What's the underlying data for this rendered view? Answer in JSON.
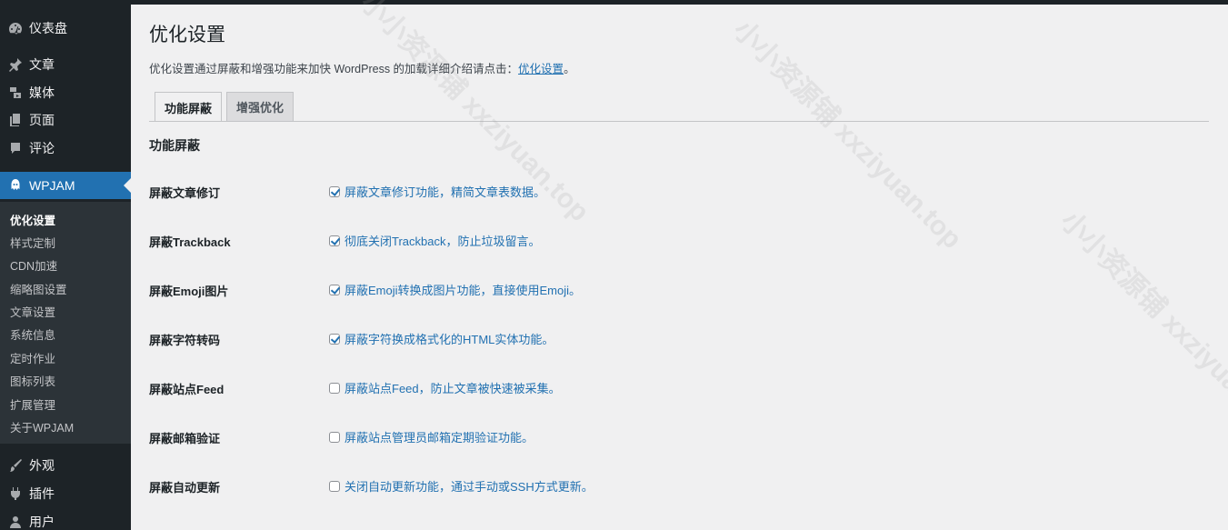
{
  "sidebar": {
    "menu": [
      {
        "label": "仪表盘",
        "icon": "dashboard-icon"
      },
      {
        "label": "文章",
        "icon": "pin-icon"
      },
      {
        "label": "媒体",
        "icon": "media-icon"
      },
      {
        "label": "页面",
        "icon": "page-icon"
      },
      {
        "label": "评论",
        "icon": "comment-icon"
      },
      {
        "label": "WPJAM",
        "icon": "wpjam-icon",
        "current": true
      },
      {
        "label": "外观",
        "icon": "brush-icon"
      },
      {
        "label": "插件",
        "icon": "plugin-icon"
      },
      {
        "label": "用户",
        "icon": "user-icon"
      }
    ],
    "submenu": [
      {
        "label": "优化设置",
        "current": true
      },
      {
        "label": "样式定制"
      },
      {
        "label": "CDN加速"
      },
      {
        "label": "缩略图设置"
      },
      {
        "label": "文章设置"
      },
      {
        "label": "系统信息"
      },
      {
        "label": "定时作业"
      },
      {
        "label": "图标列表"
      },
      {
        "label": "扩展管理"
      },
      {
        "label": "关于WPJAM"
      }
    ]
  },
  "page": {
    "title": "优化设置",
    "description": "优化设置通过屏蔽和增强功能来加快 WordPress 的加载详细介绍请点击：",
    "link_text": "优化设置",
    "link_suffix": "。"
  },
  "tabs": [
    {
      "label": "功能屏蔽",
      "active": true
    },
    {
      "label": "增强优化",
      "active": false
    }
  ],
  "section_title": "功能屏蔽",
  "settings": [
    {
      "label": "屏蔽文章修订",
      "text": "屏蔽文章修订功能，精简文章表数据。",
      "checked": true
    },
    {
      "label": "屏蔽Trackback",
      "text": "彻底关闭Trackback，防止垃圾留言。",
      "checked": true
    },
    {
      "label": "屏蔽Emoji图片",
      "text": "屏蔽Emoji转换成图片功能，直接使用Emoji。",
      "checked": true
    },
    {
      "label": "屏蔽字符转码",
      "text": "屏蔽字符换成格式化的HTML实体功能。",
      "checked": true
    },
    {
      "label": "屏蔽站点Feed",
      "text": "屏蔽站点Feed，防止文章被快速被采集。",
      "checked": false
    },
    {
      "label": "屏蔽邮箱验证",
      "text": "屏蔽站点管理员邮箱定期验证功能。",
      "checked": false
    },
    {
      "label": "屏蔽自动更新",
      "text": "关闭自动更新功能，通过手动或SSH方式更新。",
      "checked": false
    }
  ],
  "watermark": "小小资源铺 xxziyuan.top",
  "colors": {
    "sidebar_bg": "#1d2327",
    "submenu_bg": "#2c3338",
    "accent": "#2271b1",
    "page_bg": "#f0f0f1"
  }
}
